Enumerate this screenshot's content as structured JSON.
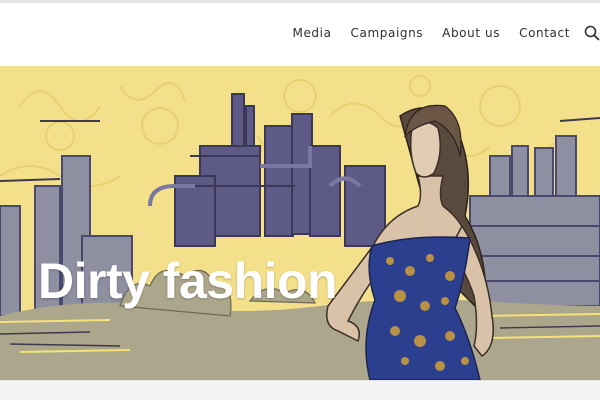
{
  "nav": {
    "items": [
      {
        "label": "Media"
      },
      {
        "label": "Campaigns"
      },
      {
        "label": "About us"
      },
      {
        "label": "Contact"
      }
    ],
    "search_icon": "search-icon"
  },
  "hero": {
    "title": "Dirty fashion",
    "illustration": "sketch-woman-in-sequin-dress-before-industrial-skyline"
  },
  "colors": {
    "sky_yellow": "#f4e08a",
    "factory_purple": "#5e5a86",
    "ground_khaki": "#aca68c",
    "dress_blue": "#2b3f8e",
    "dress_gold": "#c99a3c"
  }
}
